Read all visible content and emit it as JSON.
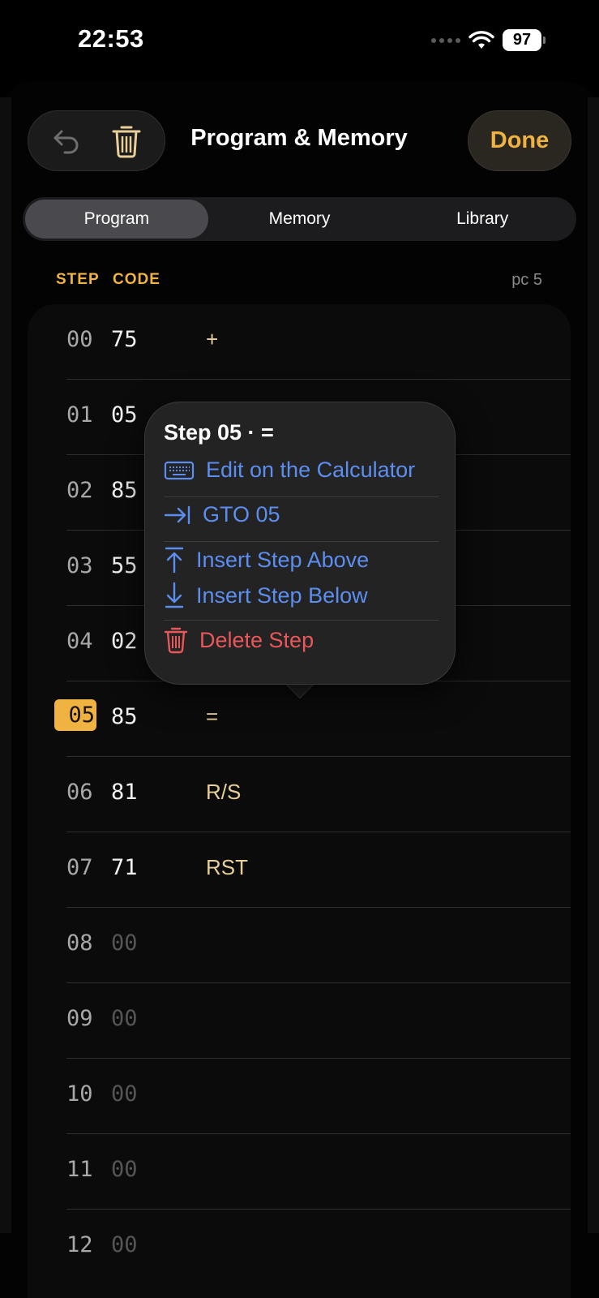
{
  "status": {
    "time": "22:53",
    "battery": "97"
  },
  "header": {
    "title": "Program & Memory",
    "done_label": "Done"
  },
  "tabs": [
    {
      "label": "Program",
      "selected": true
    },
    {
      "label": "Memory",
      "selected": false
    },
    {
      "label": "Library",
      "selected": false
    }
  ],
  "columns": {
    "step": "STEP",
    "code": "CODE",
    "pc": "pc 5"
  },
  "rows": [
    {
      "step": "00",
      "code": "75",
      "op": "+"
    },
    {
      "step": "01",
      "code": "05",
      "op": ""
    },
    {
      "step": "02",
      "code": "85",
      "op": ""
    },
    {
      "step": "03",
      "code": "55",
      "op": ""
    },
    {
      "step": "04",
      "code": "02",
      "op": ""
    },
    {
      "step": "05",
      "code": "85",
      "op": "="
    },
    {
      "step": "06",
      "code": "81",
      "op": "R/S"
    },
    {
      "step": "07",
      "code": "71",
      "op": "RST"
    },
    {
      "step": "08",
      "code": "00",
      "op": ""
    },
    {
      "step": "09",
      "code": "00",
      "op": ""
    },
    {
      "step": "10",
      "code": "00",
      "op": ""
    },
    {
      "step": "11",
      "code": "00",
      "op": ""
    },
    {
      "step": "12",
      "code": "00",
      "op": ""
    }
  ],
  "context_menu": {
    "title": "Step 05 · =",
    "edit": "Edit on the Calculator",
    "gto": "GTO 05",
    "insert_above": "Insert Step Above",
    "insert_below": "Insert Step Below",
    "delete": "Delete Step"
  },
  "colors": {
    "accent": "#f0b341",
    "link": "#5b8ef0",
    "danger": "#e8575a"
  }
}
